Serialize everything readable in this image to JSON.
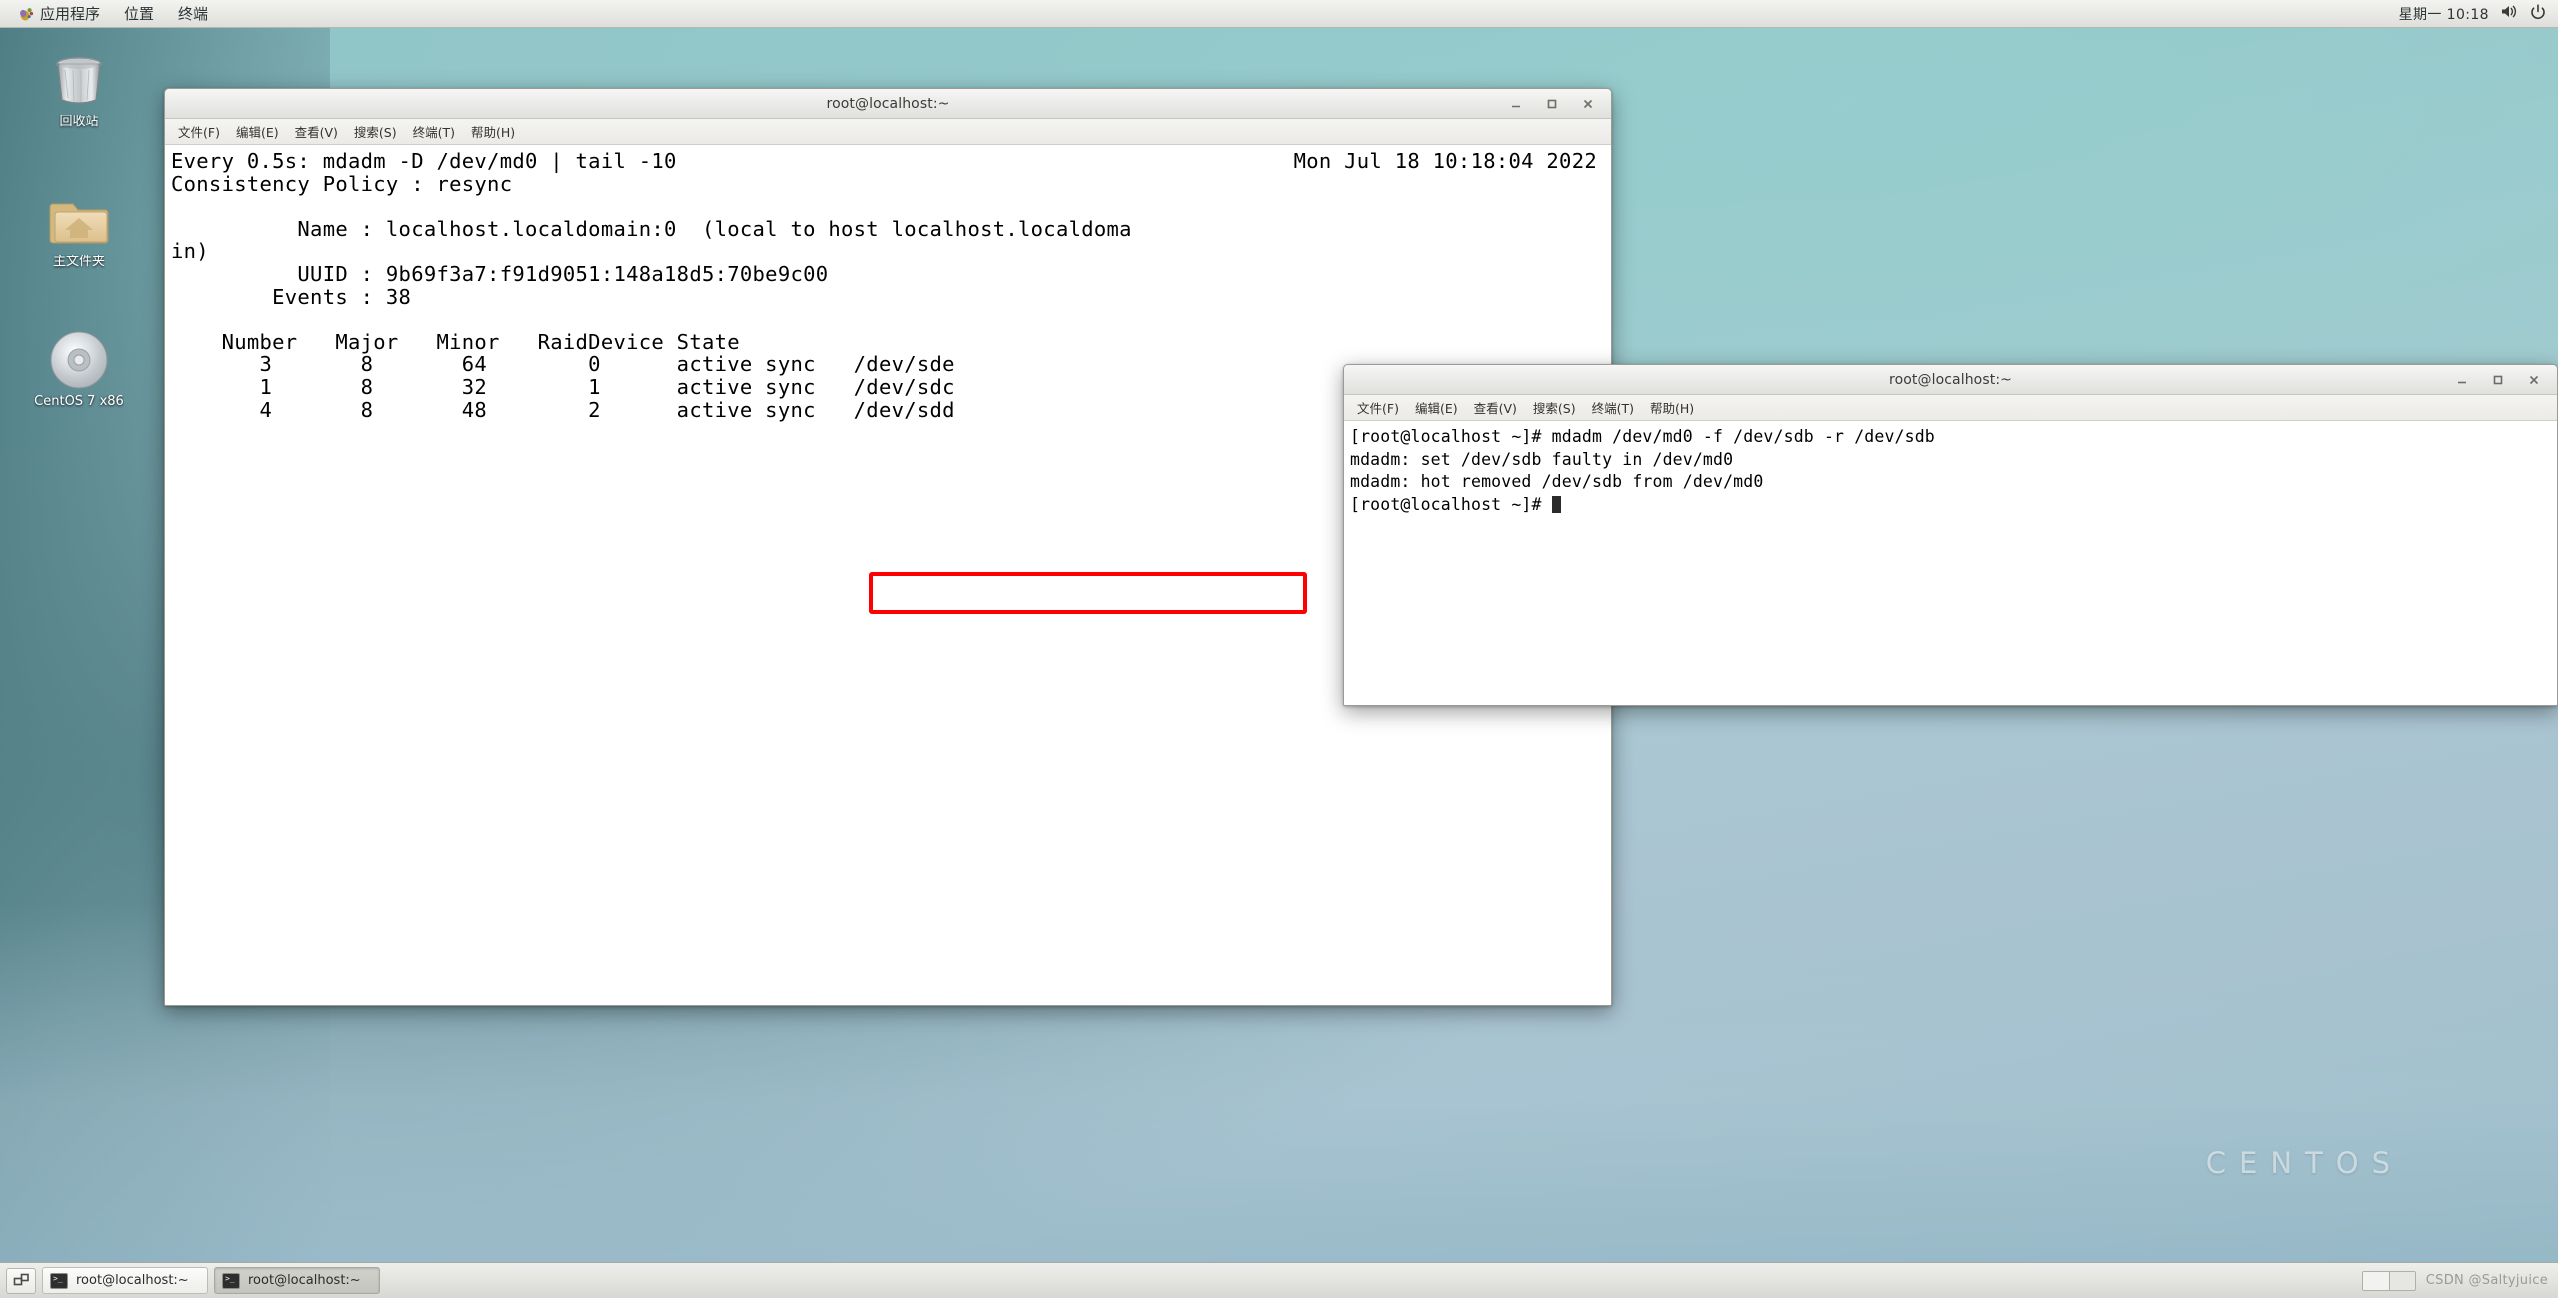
{
  "top_panel": {
    "logo_icon": "gnome-foot-icon",
    "menus": [
      "应用程序",
      "位置",
      "终端"
    ],
    "clock": "星期一 10:18",
    "volume_icon": "volume-icon",
    "power_icon": "power-icon"
  },
  "desktop": {
    "watermark": "CENTOS",
    "icons": [
      {
        "label": "回收站",
        "icon": "trash-icon"
      },
      {
        "label": "主文件夹",
        "icon": "home-folder-icon"
      },
      {
        "label": "CentOS 7 x86",
        "icon": "optical-disc-icon"
      }
    ]
  },
  "window1": {
    "title": "root@localhost:~",
    "menus": [
      "文件(F)",
      "编辑(E)",
      "查看(V)",
      "搜索(S)",
      "终端(T)",
      "帮助(H)"
    ],
    "buttons": {
      "minimize": "minimize-icon",
      "maximize": "maximize-icon",
      "close": "close-icon"
    },
    "watch_header": "Every 0.5s: mdadm -D /dev/md0 | tail -10",
    "watch_timestamp": "Mon Jul 18 10:18:04 2022",
    "content": "Consistency Policy : resync\n\n          Name : localhost.localdomain:0  (local to host localhost.localdoma\nin)\n          UUID : 9b69f3a7:f91d9051:148a18d5:70be9c00\n        Events : 38\n\n    Number   Major   Minor   RaidDevice State\n       3       8       64        0      active sync   /dev/sde\n       1       8       32        1      active sync   /dev/sdc\n       4       8       48        2      active sync   /dev/sdd",
    "highlight_color": "#ff0000",
    "highlighted_row": "active sync   /dev/sde",
    "raid_table": {
      "headers": [
        "Number",
        "Major",
        "Minor",
        "RaidDevice",
        "State"
      ],
      "rows": [
        [
          "3",
          "8",
          "64",
          "0",
          "active sync",
          "/dev/sde"
        ],
        [
          "1",
          "8",
          "32",
          "1",
          "active sync",
          "/dev/sdc"
        ],
        [
          "4",
          "8",
          "48",
          "2",
          "active sync",
          "/dev/sdd"
        ]
      ]
    },
    "details": {
      "consistency_policy": "resync",
      "name": "localhost.localdomain:0  (local to host localhost.localdomain)",
      "uuid": "9b69f3a7:f91d9051:148a18d5:70be9c00",
      "events": "38"
    }
  },
  "window2": {
    "title": "root@localhost:~",
    "menus": [
      "文件(F)",
      "编辑(E)",
      "查看(V)",
      "搜索(S)",
      "终端(T)",
      "帮助(H)"
    ],
    "buttons": {
      "minimize": "minimize-icon",
      "maximize": "maximize-icon",
      "close": "close-icon"
    },
    "lines": [
      "[root@localhost ~]# mdadm /dev/md0 -f /dev/sdb -r /dev/sdb",
      "mdadm: set /dev/sdb faulty in /dev/md0",
      "mdadm: hot removed /dev/sdb from /dev/md0"
    ],
    "prompt": "[root@localhost ~]# "
  },
  "taskbar": {
    "show_desktop_icon": "show-desktop-icon",
    "tasks": [
      {
        "label": "root@localhost:~",
        "icon": "terminal-icon",
        "active": false
      },
      {
        "label": "root@localhost:~",
        "icon": "terminal-icon",
        "active": true
      }
    ],
    "workspaces": 2,
    "active_workspace": 1,
    "watermark": "CSDN @Saltyjuice"
  }
}
